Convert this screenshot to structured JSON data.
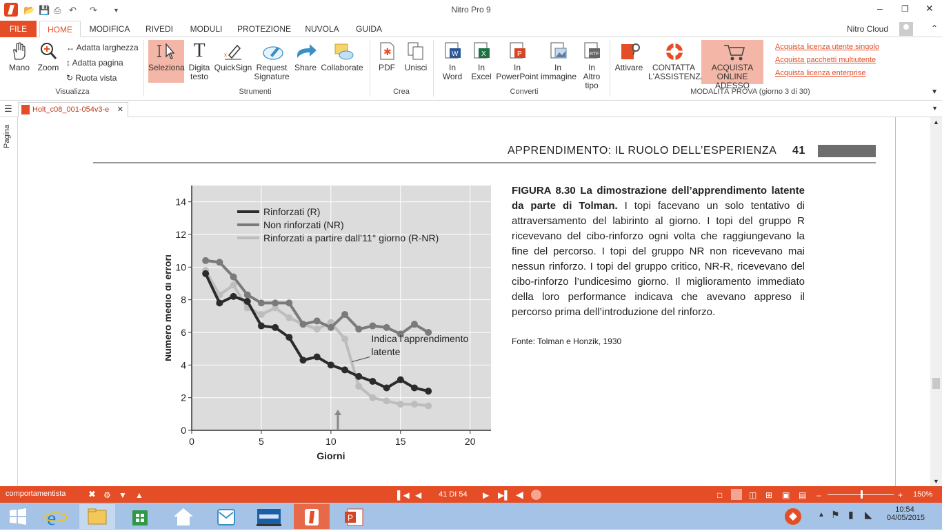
{
  "window": {
    "title": "Nitro Pro 9"
  },
  "ribbon_tabs": {
    "file": "FILE",
    "home": "HOME",
    "modifica": "MODIFICA",
    "rivedi": "RIVEDI",
    "moduli": "MODULI",
    "protezione": "PROTEZIONE",
    "nuvola": "NUVOLA",
    "guida": "GUIDA"
  },
  "account": {
    "name": "Nitro Cloud"
  },
  "ribbon": {
    "mano": "Mano",
    "zoom": "Zoom",
    "fit_width": "Adatta larghezza",
    "fit_page": "Adatta pagina",
    "rotate": "Ruota vista",
    "group_visualizza": "Visualizza",
    "seleziona": "Seleziona",
    "digita1": "Digita",
    "digita2": "testo",
    "quicksign": "QuickSign",
    "request1": "Request",
    "request2": "Signature",
    "share": "Share",
    "collaborate": "Collaborate",
    "group_strumenti": "Strumenti",
    "pdf": "PDF",
    "unisci": "Unisci",
    "group_crea": "Crea",
    "in": "In",
    "word": "Word",
    "excel": "Excel",
    "powerpoint": "PowerPoint",
    "immagine": "immagine",
    "altro1": "Altro",
    "altro2": "tipo",
    "group_converti": "Converti",
    "attivare": "Attivare",
    "contatta1": "CONTATTA",
    "contatta2": "L'ASSISTENZA",
    "acquista1": "ACQUISTA",
    "acquista2": "ONLINE ADESSO",
    "trial": "MODALITÀ PROVA (giorno 3 di 30)",
    "link1": "Acquista licenza utente singolo",
    "link2": "Acquista pacchetti multiutente",
    "link3": "Acquista licenza enterprise"
  },
  "document": {
    "tab_name": "Holt_c08_001-054v3-e",
    "side_panel_label": "Pagina"
  },
  "page": {
    "header": "APPRENDIMENTO: IL RUOLO DELL’ESPERIENZA",
    "page_number": "41",
    "caption_title": "FIGURA 8.30  La dimostrazione dell’apprendimento latente da parte di Tolman.",
    "caption_body": "I topi facevano un solo tentativo di attraversamento del labirinto al giorno. I topi del gruppo R ricevevano del cibo-rinforzo ogni volta che raggiungevano la fine del percorso. I topi del gruppo NR non ricevevano mai nessun rinforzo. I topi del gruppo critico, NR-R, ricevevano del cibo-rinforzo l’undicesimo giorno. Il miglioramento immediato della loro performance indicava che avevano appreso il percorso prima dell’introduzione del rinforzo.",
    "source": "Fonte: Tolman e Honzik, 1930"
  },
  "chart_data": {
    "type": "line",
    "xlabel": "Giorni",
    "ylabel": "Numero medio di errori",
    "xlim": [
      0,
      21.5
    ],
    "ylim": [
      0,
      15
    ],
    "xticks": [
      "0",
      "5",
      "10",
      "15",
      "20"
    ],
    "yticks": [
      "0",
      "2",
      "4",
      "6",
      "8",
      "10",
      "12",
      "14"
    ],
    "grid": true,
    "legend": "top-left",
    "annotation": {
      "text1": "Indica l’apprendimento",
      "text2": "latente",
      "arrow_x": 10.5
    },
    "series": [
      {
        "name": "Rinforzati (R)",
        "color": "#2b2b2b",
        "x": [
          1,
          2,
          3,
          4,
          5,
          6,
          7,
          8,
          9,
          10,
          11,
          12,
          13,
          14,
          15,
          16,
          17
        ],
        "values": [
          9.6,
          7.8,
          8.2,
          7.9,
          6.4,
          6.3,
          5.7,
          4.3,
          4.5,
          4.0,
          3.7,
          3.3,
          3.0,
          2.6,
          3.1,
          2.6,
          2.4
        ]
      },
      {
        "name": "Non rinforzati (NR)",
        "color": "#7a7a7a",
        "x": [
          1,
          2,
          3,
          4,
          5,
          6,
          7,
          8,
          9,
          10,
          11,
          12,
          13,
          14,
          15,
          16,
          17
        ],
        "values": [
          10.4,
          10.3,
          9.4,
          8.3,
          7.8,
          7.8,
          7.8,
          6.5,
          6.7,
          6.3,
          7.1,
          6.2,
          6.4,
          6.3,
          5.9,
          6.5,
          6.0
        ]
      },
      {
        "name": "Rinforzati a partire dall’11° giorno (R-NR)",
        "color": "#bdbdbd",
        "x": [
          1,
          2,
          3,
          4,
          5,
          6,
          7,
          8,
          9,
          10,
          11,
          12,
          13,
          14,
          15,
          16,
          17
        ],
        "values": [
          9.8,
          8.3,
          8.9,
          7.5,
          7.1,
          7.5,
          6.9,
          6.5,
          6.2,
          6.6,
          5.6,
          2.7,
          2.0,
          1.8,
          1.6,
          1.6,
          1.5
        ]
      }
    ]
  },
  "statusbar": {
    "search": "comportamentista",
    "page_indicator": "41 DI 54",
    "zoom": "150%"
  },
  "taskbar": {
    "time": "10:54",
    "date": "04/05/2015"
  }
}
